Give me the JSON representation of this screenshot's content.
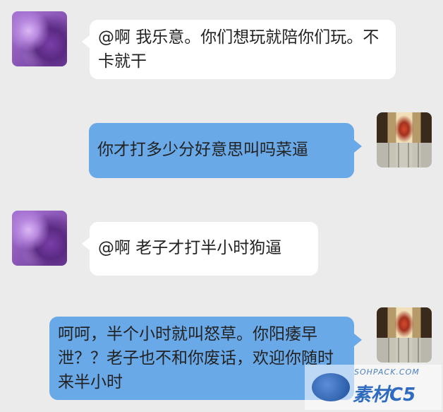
{
  "messages": [
    {
      "direction": "in",
      "text": "@啊 我乐意。你们想玩就陪你们玩。不卡就干"
    },
    {
      "direction": "out",
      "text": "你才打多少分好意思叫吗菜逼"
    },
    {
      "direction": "in",
      "text": "@啊 老子才打半小时狗逼"
    },
    {
      "direction": "out",
      "text": "呵呵，半个小时就叫怒草。你阳痿早泄？？老子也不和你废话，欢迎你随时来半小时"
    }
  ],
  "watermark": {
    "top_text": "SOHPACK.COM",
    "bottom_text": "素材C5"
  }
}
